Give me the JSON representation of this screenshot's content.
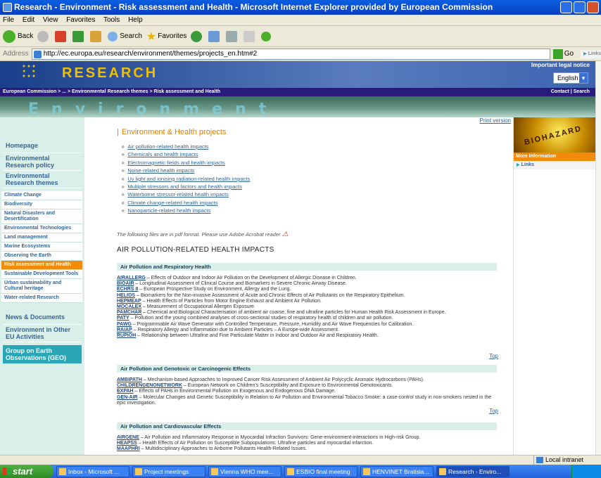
{
  "window": {
    "title": "Research - Environment - Risk assessment and Health - Microsoft Internet Explorer provided by European Commission"
  },
  "menu": [
    "File",
    "Edit",
    "View",
    "Favorites",
    "Tools",
    "Help"
  ],
  "toolbar": {
    "back": "Back",
    "search": "Search",
    "favorites": "Favorites"
  },
  "address": {
    "label": "Address",
    "url": "http://ec.europa.eu/research/environment/themes/projects_en.htm#2",
    "go": "Go",
    "links": "Links"
  },
  "site": {
    "logo_text": "RESEARCH",
    "legal_notice": "Important legal notice",
    "language": "English",
    "breadcrumb": "European Commission > ... > Environmental Research themes > Risk assessment and Health",
    "contact": "Contact | Search",
    "section_word": "Environment"
  },
  "nav": {
    "homepage": "Homepage",
    "policy": "Environmental Research policy",
    "themes": "Environmental Research themes",
    "subitems": [
      "Climate Change",
      "Biodiversity",
      "Natural Disasters and Desertification",
      "Environmental Technologies",
      "Land management",
      "Marine Ecosystems",
      "Observing the Earth",
      "Risk assessment and Health",
      "Sustainable Development Tools",
      "Urban sustainability and Cultural heritage",
      "Water-related Research"
    ],
    "active_index": 7,
    "news": "News & Documents",
    "env_eu": "Environment in Other EU Activities",
    "geo": "Group on Earth Observations (GEO)"
  },
  "content": {
    "print": "Print version",
    "title": "Environment & Health projects",
    "projects": [
      "Air pollution-related health impacts",
      "Chemicals and health impacts",
      "Electromagnetic fields and health impacts",
      "Noise-related health impacts",
      "Uv light and ionising radiation-related health impacts",
      "Multiple stressors and factors and health impacts",
      "Waterborne stressor-related health impacts",
      "Climate change-related health impacts",
      "Nanoparticle-related health impacts"
    ],
    "pdf_note": "The following files are in pdf format. Please use Adobe Acrobat reader",
    "air_heading": "AIR POLLUTION-RELATED HEALTH IMPACTS",
    "top": "Top",
    "sections": [
      {
        "title": "Air Pollution and Respiratory Health",
        "items": [
          {
            "code": "AIRALLERG",
            "text": " – Effects of Outdoor and Indoor Air Pollution on the Development of Allergic Disease in Children."
          },
          {
            "code": "BIOAIR",
            "text": " – Longitudinal Assessment of Clinical Course and Biomarkers in Severe Chronic Airway Disease."
          },
          {
            "code": "ECHRS II",
            "text": " – European Prospective Study on Environment, Allergy and the Lung."
          },
          {
            "code": "HELIOS",
            "text": " – Biomarkers for the Non-invasive Assessment of Acute and Chronic Effects of Air Pollutants on the Respiratory Epithelium."
          },
          {
            "code": "HEPMEAP",
            "text": " – Health Effects of Particles from Motor Engine Exhaust and Ambient Air Pollution."
          },
          {
            "code": "MOCALEX",
            "text": " – Measurement of Occupational Allergen Exposure."
          },
          {
            "code": "PAMCHAR",
            "text": " – Chemical and Biological Characterisation of ambient air coarse, fine and ultrafine particles for Human Health Risk Assessment in Europe."
          },
          {
            "code": "PATY",
            "text": " – Pollution and the young combined analyses of cross-sectional studies of respiratory health of children and air pollution."
          },
          {
            "code": "PAWG",
            "text": " – Programmable Air Wave Generator with Controlled Temperature, Pressure, Humidity and Air Wave Frequencies for Calibration."
          },
          {
            "code": "RAIAP",
            "text": " – Respiratory Allergy and Inflammation due to Ambient Particles – A Europe-wide Assessment."
          },
          {
            "code": "RUPIOH",
            "text": " – Relationship between Ultrafine and Fine Particulate Matter in Indoor and Outdoor Air and Respiratory Health."
          }
        ]
      },
      {
        "title": "Air Pollution and Genotoxic or Carcinogenic Effects",
        "items": [
          {
            "code": "AMBIPATH",
            "text": " – Mechanism-based Approaches to Improved Cancer Risk Assessment of Ambient Air Polycyclic Aromatic Hydrocarbons (PAHs)."
          },
          {
            "code": "CHILDRENGENONETWORK",
            "text": " – European Network on Children's Susceptibility and Exposure to Environmental Genotoxicants."
          },
          {
            "code": "EXPAH",
            "text": " – Effects of PAHs in Environmental Pollution on Exogenous and Endogenous DNA Damage."
          },
          {
            "code": "GEN-AIR",
            "text": " – Molecular Changes and Genetic Susceptibility in Relation to Air Pollution and Environmental Tobacco Smoke: a case-control study in non-smokers nested in the epic investigation."
          }
        ]
      },
      {
        "title": "Air Pollution and Cardiovascular Effects",
        "items": [
          {
            "code": "AIRGENE",
            "text": " – Air Pollution and Inflammatory Response in Myocardial Infraction Survivors: Gene-environment-interactions in High-risk Group."
          },
          {
            "code": "HEAPSS",
            "text": " – Health Effects of Air Pollution on Susceptible Subpopulations: Ultrafine particles and myocardial infarction."
          },
          {
            "code": "MAAPHRI",
            "text": " – Multidisciplinary Approaches to Airborne Pollutants Health-Related Issues."
          }
        ]
      }
    ]
  },
  "right": {
    "image_text": "BIOHAZARD",
    "more_info": "More Information",
    "links": "Links"
  },
  "status": {
    "zone": "Local intranet"
  },
  "taskbar": {
    "start": "start",
    "tasks": [
      "Inbox - Microsoft ...",
      "Project meetings",
      "Vienna WHO mee...",
      "ESBIO final meeting",
      "HENVINET Bratisla...",
      "Research - Enviro..."
    ],
    "active_index": 5
  }
}
